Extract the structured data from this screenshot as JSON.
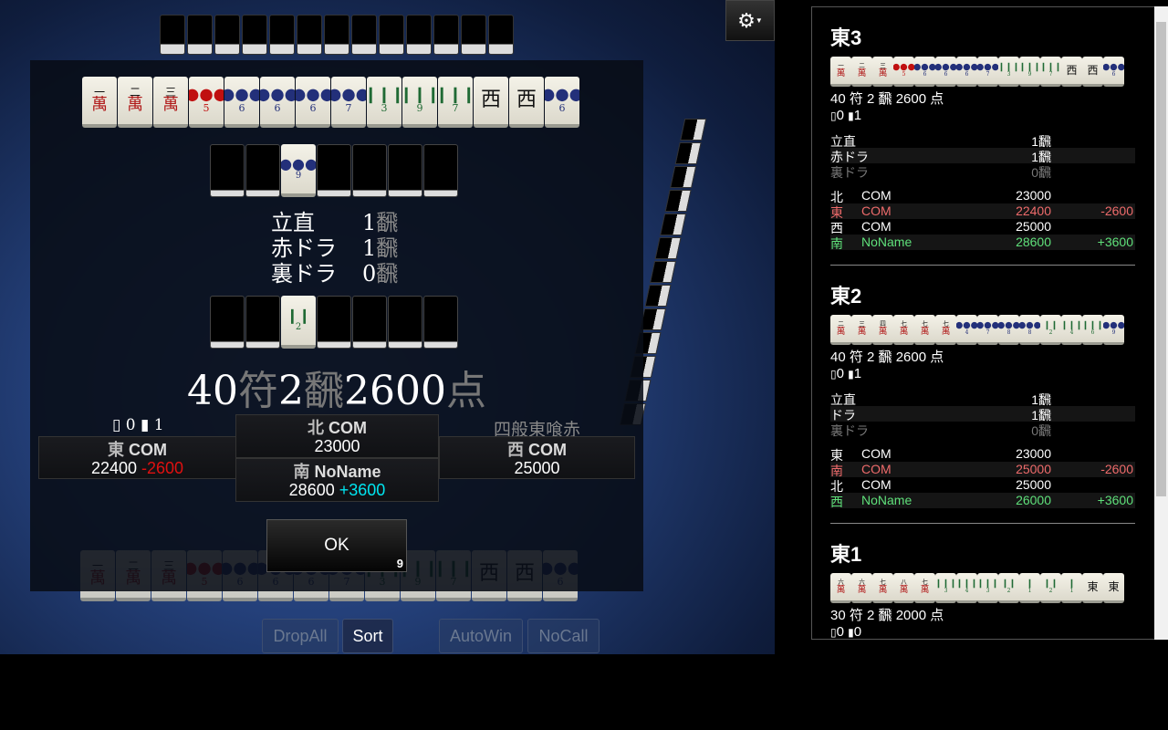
{
  "game": {
    "hand": [
      "1m",
      "2m",
      "3m",
      "5pr",
      "6p",
      "6p",
      "6p",
      "7p",
      "3s",
      "9s",
      "7s",
      "W",
      "W",
      "6p"
    ],
    "dora": [
      "B",
      "B",
      "9p",
      "B",
      "B",
      "B",
      "B"
    ],
    "uradora": [
      "B",
      "B",
      "2s",
      "B",
      "B",
      "B",
      "B"
    ],
    "yaku": [
      {
        "name": "立直",
        "han": "1",
        "unit": "飜"
      },
      {
        "name": "赤ドラ",
        "han": "1",
        "unit": "飜"
      },
      {
        "name": "裏ドラ",
        "han": "0",
        "unit": "飜"
      }
    ],
    "score": {
      "fu": "40",
      "fu_unit": "符",
      "han": "2",
      "han_unit": "飜",
      "points": "2600",
      "points_unit": "点"
    },
    "sticks": {
      "honba": "0",
      "riichi": "1"
    },
    "yaku_name": "四般東喰赤",
    "players": {
      "east": {
        "wind": "東",
        "name": "COM",
        "score": "22400",
        "delta": "-2600"
      },
      "north": {
        "wind": "北",
        "name": "COM",
        "score": "23000",
        "delta": ""
      },
      "south": {
        "wind": "南",
        "name": "NoName",
        "score": "28600",
        "delta": "+3600"
      },
      "west": {
        "wind": "西",
        "name": "COM",
        "score": "25000",
        "delta": ""
      }
    },
    "ok": {
      "label": "OK",
      "countdown": "9"
    },
    "buttons": {
      "dropall": "DropAll",
      "sort": "Sort",
      "autowin": "AutoWin",
      "nocall": "NoCall"
    },
    "gear_icon": "gear-icon"
  },
  "history": [
    {
      "title": "東3",
      "tiles": [
        "1m",
        "2m",
        "3m",
        "5pr",
        "6p",
        "6p",
        "6p",
        "7p",
        "3s",
        "9s",
        "7s",
        "W",
        "W",
        "6p"
      ],
      "summary": "40 符 2 飜 2600 点",
      "honba": "0",
      "riichi": "1",
      "yaku": [
        {
          "name": "立直",
          "han": "1飜"
        },
        {
          "name": "赤ドラ",
          "han": "1飜"
        },
        {
          "name": "裏ドラ",
          "han": "0飜",
          "dim": true
        }
      ],
      "players": [
        {
          "wind": "北",
          "name": "COM",
          "score": "23000",
          "delta": ""
        },
        {
          "wind": "東",
          "name": "COM",
          "score": "22400",
          "delta": "-2600",
          "cls": "lose"
        },
        {
          "wind": "西",
          "name": "COM",
          "score": "25000",
          "delta": ""
        },
        {
          "wind": "南",
          "name": "NoName",
          "score": "28600",
          "delta": "+3600",
          "cls": "win"
        }
      ]
    },
    {
      "title": "東2",
      "tiles": [
        "2m",
        "3m",
        "4m",
        "7m",
        "7m",
        "7m",
        "4p",
        "7p",
        "8p",
        "8p",
        "2s",
        "4s",
        "6s",
        "9p"
      ],
      "summary": "40 符 2 飜 2600 点",
      "honba": "0",
      "riichi": "1",
      "yaku": [
        {
          "name": "立直",
          "han": "1飜"
        },
        {
          "name": "ドラ",
          "han": "1飜"
        },
        {
          "name": "裏ドラ",
          "han": "0飜",
          "dim": true
        }
      ],
      "players": [
        {
          "wind": "東",
          "name": "COM",
          "score": "23000",
          "delta": ""
        },
        {
          "wind": "南",
          "name": "COM",
          "score": "25000",
          "delta": "-2600",
          "cls": "lose"
        },
        {
          "wind": "北",
          "name": "COM",
          "score": "25000",
          "delta": ""
        },
        {
          "wind": "西",
          "name": "NoName",
          "score": "26000",
          "delta": "+3600",
          "cls": "win"
        }
      ]
    },
    {
      "title": "東1",
      "tiles": [
        "6m",
        "6m",
        "7m",
        "8m",
        "7m",
        "3s",
        "4s",
        "3s",
        "2s",
        "1s",
        "2s",
        "1s",
        "E",
        "E"
      ],
      "summary": "30 符 2 飜 2000 点",
      "honba": "0",
      "riichi": "0",
      "yaku": [],
      "players": []
    }
  ]
}
